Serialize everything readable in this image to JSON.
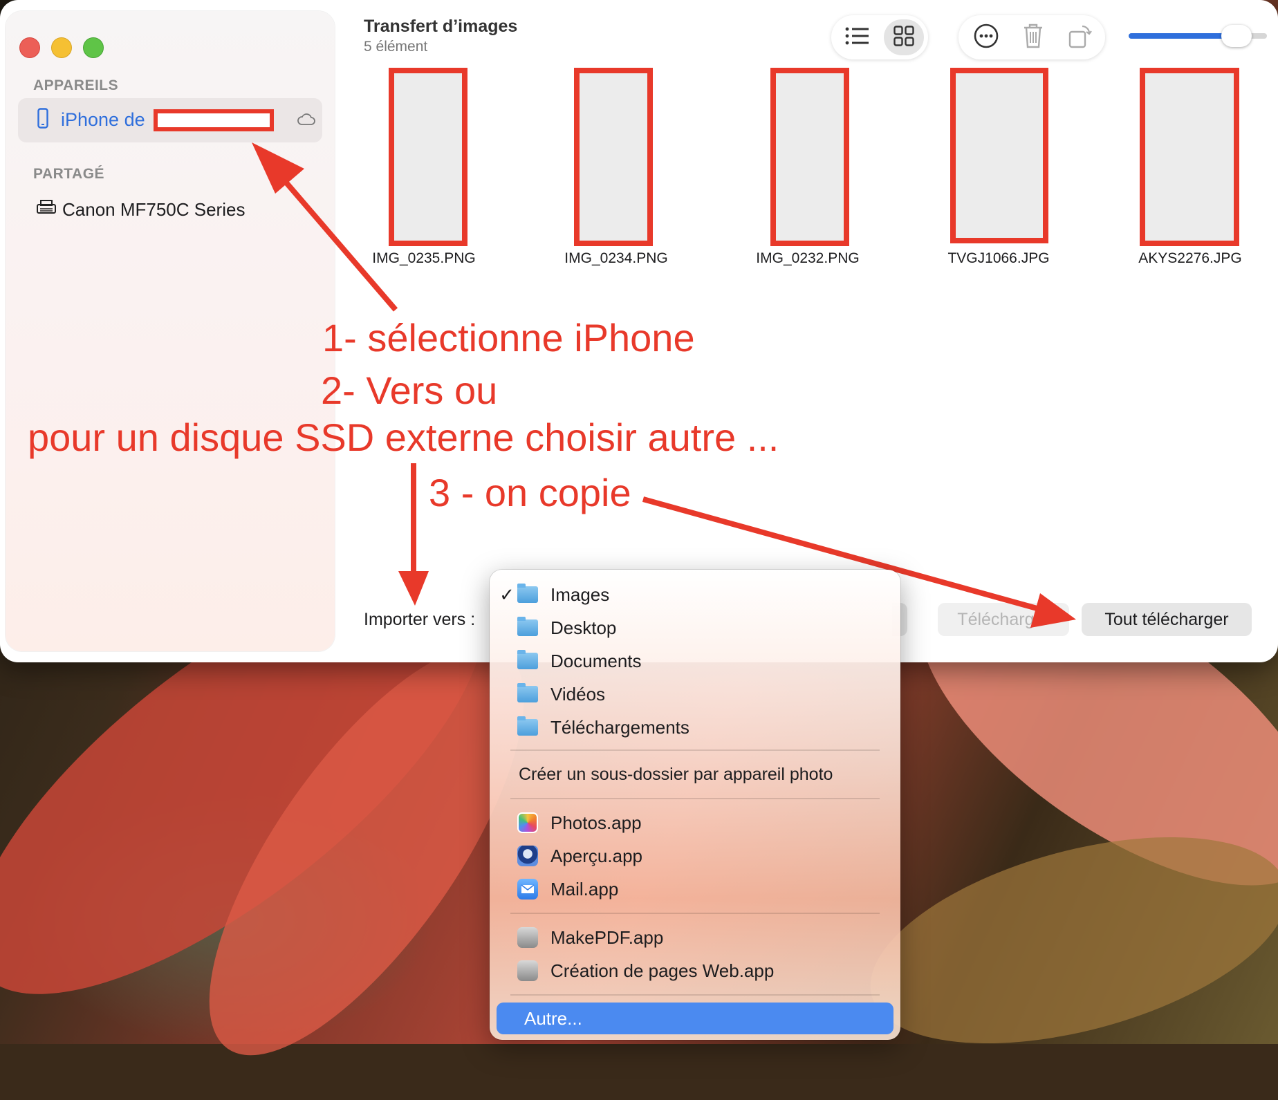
{
  "window": {
    "title": "Transfert d’images",
    "subtitle": "5 élément"
  },
  "sidebar": {
    "devices_heading": "APPAREILS",
    "device_name": "iPhone de",
    "shared_heading": "PARTAGÉ",
    "printer_name": "Canon MF750C Series"
  },
  "toolbar": {
    "list_view_icon": "list-icon",
    "grid_view_icon": "grid-icon",
    "more_icon": "ellipsis-circle-icon",
    "delete_icon": "trash-icon",
    "rotate_icon": "rotate-icon",
    "thumbnail_size": 0.78
  },
  "thumbnails": [
    {
      "filename": "IMG_0235.PNG"
    },
    {
      "filename": "IMG_0234.PNG"
    },
    {
      "filename": "IMG_0232.PNG"
    },
    {
      "filename": "TVGJ1066.JPG"
    },
    {
      "filename": "AKYS2276.JPG"
    }
  ],
  "annotations": {
    "step1": "1- sélectionne iPhone",
    "step2": "2- Vers ou",
    "step2b": "pour un disque SSD externe choisir autre ...",
    "step3": "3 - on copie",
    "color": "#e8392a"
  },
  "bottom_bar": {
    "import_label": "Importer vers :",
    "download_button": "Télécharger",
    "download_all_button": "Tout télécharger"
  },
  "menu": {
    "checkmark": "✓",
    "folders": [
      "Images",
      "Desktop",
      "Documents",
      "Vidéos",
      "Téléchargements"
    ],
    "subfolder_option": "Créer un sous-dossier par appareil photo",
    "apps": [
      "Photos.app",
      "Aperçu.app",
      "Mail.app"
    ],
    "automator_apps": [
      "MakePDF.app",
      "Création de pages Web.app"
    ],
    "other": "Autre...",
    "selected": "Images",
    "highlighted": "Autre..."
  },
  "colors": {
    "accent": "#2f6fdc",
    "annotation_red": "#e8392a",
    "menu_highlight": "#4b8af0"
  }
}
